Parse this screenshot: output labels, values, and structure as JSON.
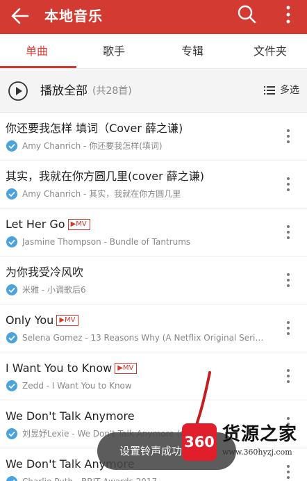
{
  "header": {
    "title": "本地音乐",
    "background_color": "#d33a31",
    "back_icon": "back-arrow-icon",
    "search_icon": "search-icon",
    "more_icon": "more-vertical-icon"
  },
  "tabs": [
    {
      "label": "单曲",
      "active": true
    },
    {
      "label": "歌手",
      "active": false
    },
    {
      "label": "专辑",
      "active": false
    },
    {
      "label": "文件夹",
      "active": false
    }
  ],
  "play_all": {
    "label": "播放全部",
    "count": "(共28首)",
    "multi_select_label": "多选"
  },
  "songs": [
    {
      "title": "你还要我怎样 填词（Cover 薛之谦)",
      "mv": "",
      "subtitle": "Amy Chanrich - 你还要我怎样(填词)"
    },
    {
      "title": "其实，我就在你方圆几里(cover 薛之谦)",
      "mv": "",
      "subtitle": "Amy Chanrich - 其实，我就在你方圆几里"
    },
    {
      "title": "Let Her Go",
      "mv": "▶MV",
      "subtitle": "Jasmine Thompson - Bundle of Tantrums"
    },
    {
      "title": "为你我受冷风吹",
      "mv": "",
      "subtitle": "米雅 - 小调歌后6"
    },
    {
      "title": "Only You",
      "mv": "▶MV",
      "subtitle": "Selena Gomez - 13 Reasons Why (A Netflix Original Series S..."
    },
    {
      "title": "I Want You to Know",
      "mv": "▶MV",
      "subtitle": "Zedd - I Want You to Know"
    },
    {
      "title": "We Don't Talk Anymore",
      "mv": "",
      "subtitle": "刘昱妤Lexie - We Don't Talk Anymore (Cl"
    },
    {
      "title": "We Don't Talk Anymore",
      "mv": "",
      "subtitle": "Charlie Puth - BRIT Awards 2017"
    }
  ],
  "toast": {
    "text": "设置铃声成功"
  },
  "watermark": {
    "badge": "360",
    "brand": "货源之家",
    "url": "www.360hyzj.com"
  }
}
